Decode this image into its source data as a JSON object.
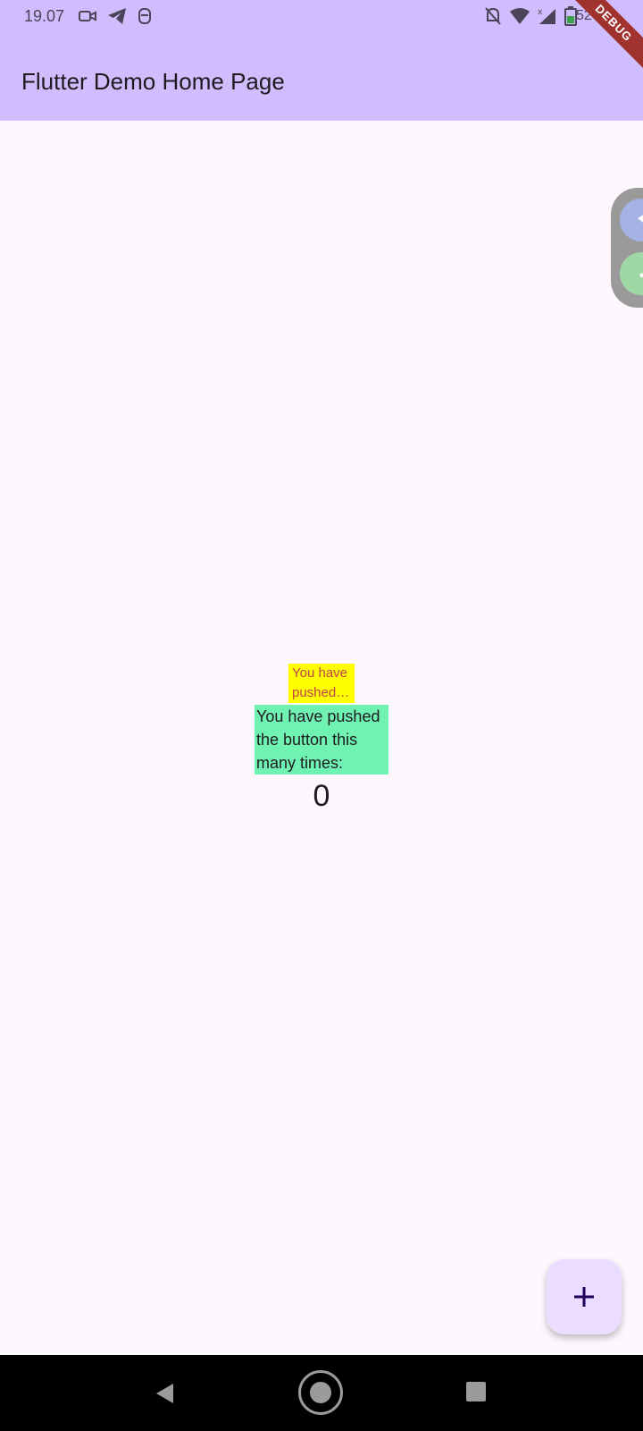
{
  "status_bar": {
    "time": "19.07",
    "battery_text": "52",
    "left_icons": [
      "video-camera-icon",
      "telegram-icon",
      "app-notification-icon"
    ],
    "right_icons": [
      "notifications-off-icon",
      "wifi-icon",
      "signal-icon",
      "battery-icon"
    ]
  },
  "app_bar": {
    "title": "Flutter Demo Home Page",
    "background": "#d1bdfd"
  },
  "debug_banner": {
    "label": "DEBUG"
  },
  "overlay": {
    "top_button_icon": "share-icon",
    "bottom_button_icon": "more-dots-icon"
  },
  "main": {
    "yellow_label_line1": "You have",
    "yellow_label_line2": "pushed t...",
    "green_label": "You have pushed the button this many times:",
    "counter": "0"
  },
  "fab": {
    "icon": "plus-icon",
    "accent": "#eaddff"
  },
  "nav_bar": {
    "buttons": [
      "back-icon",
      "home-icon",
      "recents-icon"
    ]
  }
}
